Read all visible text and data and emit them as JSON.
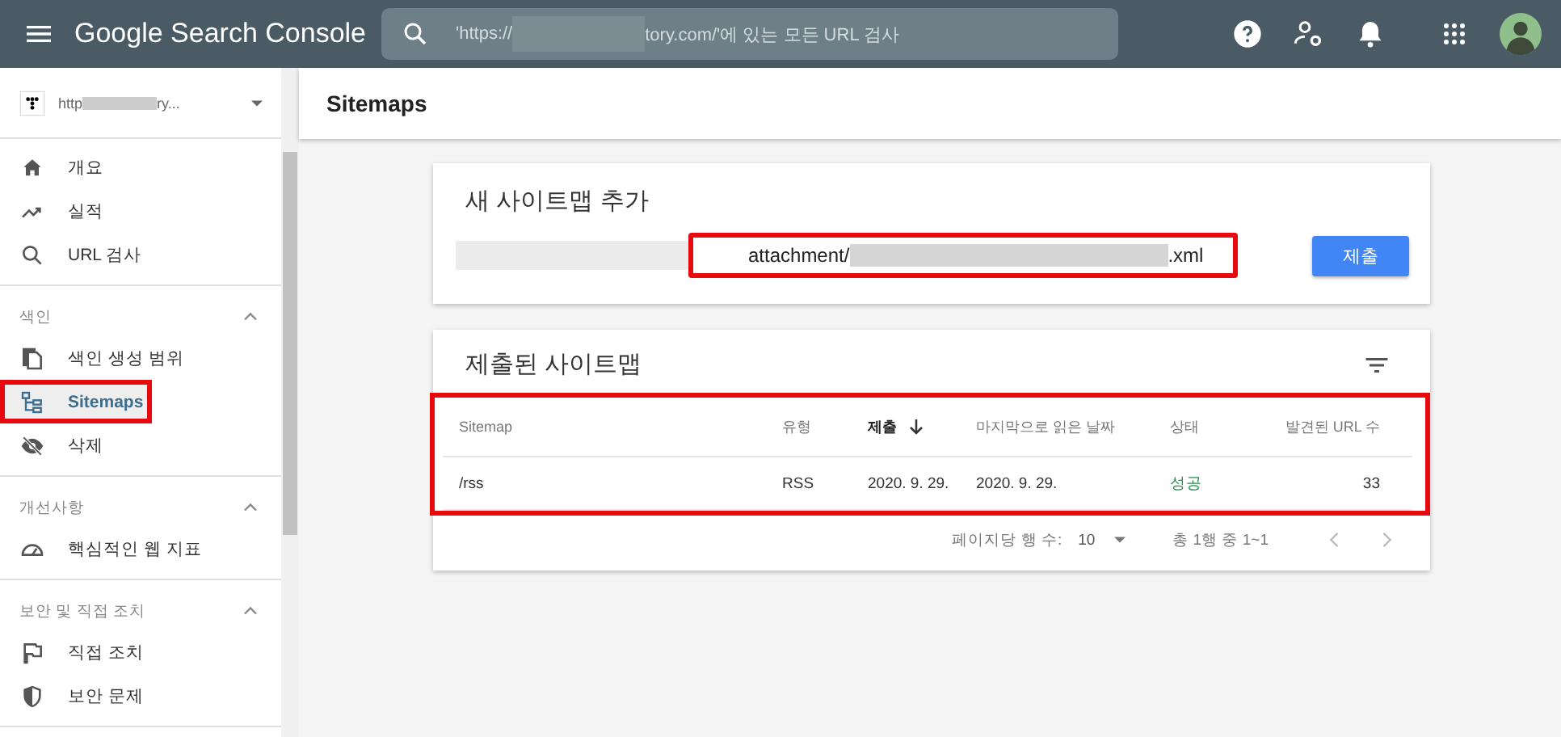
{
  "app_bar": {
    "product": "Google Search Console",
    "search": {
      "placeholder_start": "'https://",
      "placeholder_end": "tory.com/'에 있는 모든 URL 검사"
    }
  },
  "property": {
    "start": "http",
    "end": "ry..."
  },
  "sidebar": {
    "sections": [
      {
        "items": [
          {
            "label": "개요",
            "selected": false,
            "highlighted": false
          },
          {
            "label": "실적",
            "selected": false,
            "highlighted": false
          },
          {
            "label": "URL 검사",
            "selected": false,
            "highlighted": false
          }
        ]
      },
      {
        "title": "색인",
        "expanded": true,
        "items": [
          {
            "label": "색인 생성 범위",
            "selected": false,
            "highlighted": false
          },
          {
            "label": "Sitemaps",
            "selected": true,
            "highlighted": true
          },
          {
            "label": "삭제",
            "selected": false,
            "highlighted": false
          }
        ]
      },
      {
        "title": "개선사항",
        "expanded": true,
        "items": [
          {
            "label": "핵심적인 웹 지표",
            "selected": false,
            "highlighted": false
          }
        ]
      },
      {
        "title": "보안 및 직접 조치",
        "expanded": true,
        "items": [
          {
            "label": "직접 조치",
            "selected": false,
            "highlighted": false
          },
          {
            "label": "보안 문제",
            "selected": false,
            "highlighted": false
          }
        ]
      }
    ]
  },
  "page_title": "Sitemaps",
  "add_card": {
    "title": "새 사이트맵 추가",
    "value_start": "attachment/",
    "value_end": ".xml",
    "highlighted": true,
    "submit": "제출"
  },
  "submitted_card": {
    "title": "제출된 사이트맵",
    "highlighted": true,
    "table": {
      "columns": [
        {
          "label": "Sitemap",
          "kind": "text",
          "sorted": false
        },
        {
          "label": "유형",
          "kind": "text",
          "sorted": false
        },
        {
          "label": "제출",
          "kind": "text",
          "sorted": true
        },
        {
          "label": "마지막으로 읽은 날짜",
          "kind": "text",
          "sorted": false
        },
        {
          "label": "상태",
          "kind": "status",
          "sorted": false
        },
        {
          "label": "발견된 URL 수",
          "kind": "number",
          "sorted": false
        }
      ],
      "rows": [
        [
          "/rss",
          "RSS",
          "2020. 9. 29.",
          "2020. 9. 29.",
          "성공",
          "33"
        ]
      ]
    },
    "pagination": {
      "rows_label": "페이지당 행 수:",
      "rows_value": "10",
      "range": "총 1행 중 1~1",
      "prev_disabled": true,
      "next_disabled": true
    }
  }
}
